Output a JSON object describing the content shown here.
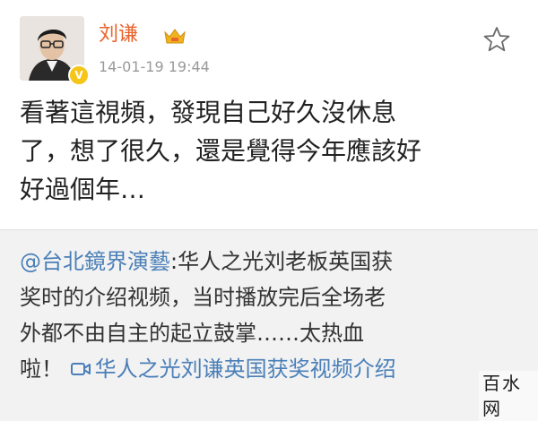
{
  "user": {
    "name": "刘谦",
    "timestamp": "14-01-19 19:44",
    "verified_badge": "V"
  },
  "post": {
    "line1": "看著這視頻，發現自己好久沒休息",
    "line2": "了，想了很久，還是覺得今年應該好",
    "line3": "好過個年…"
  },
  "repost": {
    "mention": "@台北鏡界演藝",
    "text_line1_rest": ":华人之光刘老板英国获",
    "text_line2": "奖时的介绍视频，当时播放完后全场老",
    "text_line3": "外都不由自主的起立鼓掌……太热血",
    "text_line4_prefix": "啦！",
    "video_link": "华人之光刘谦英国获奖视频介绍"
  },
  "watermark": "百水网",
  "colors": {
    "name": "#e8642c",
    "link": "#4a7fb8",
    "badge": "#f5c518",
    "repost_bg": "#f2f2f2"
  },
  "icons": {
    "favorite": "star-outline-icon",
    "member": "crown-icon",
    "video": "video-camera-icon"
  }
}
